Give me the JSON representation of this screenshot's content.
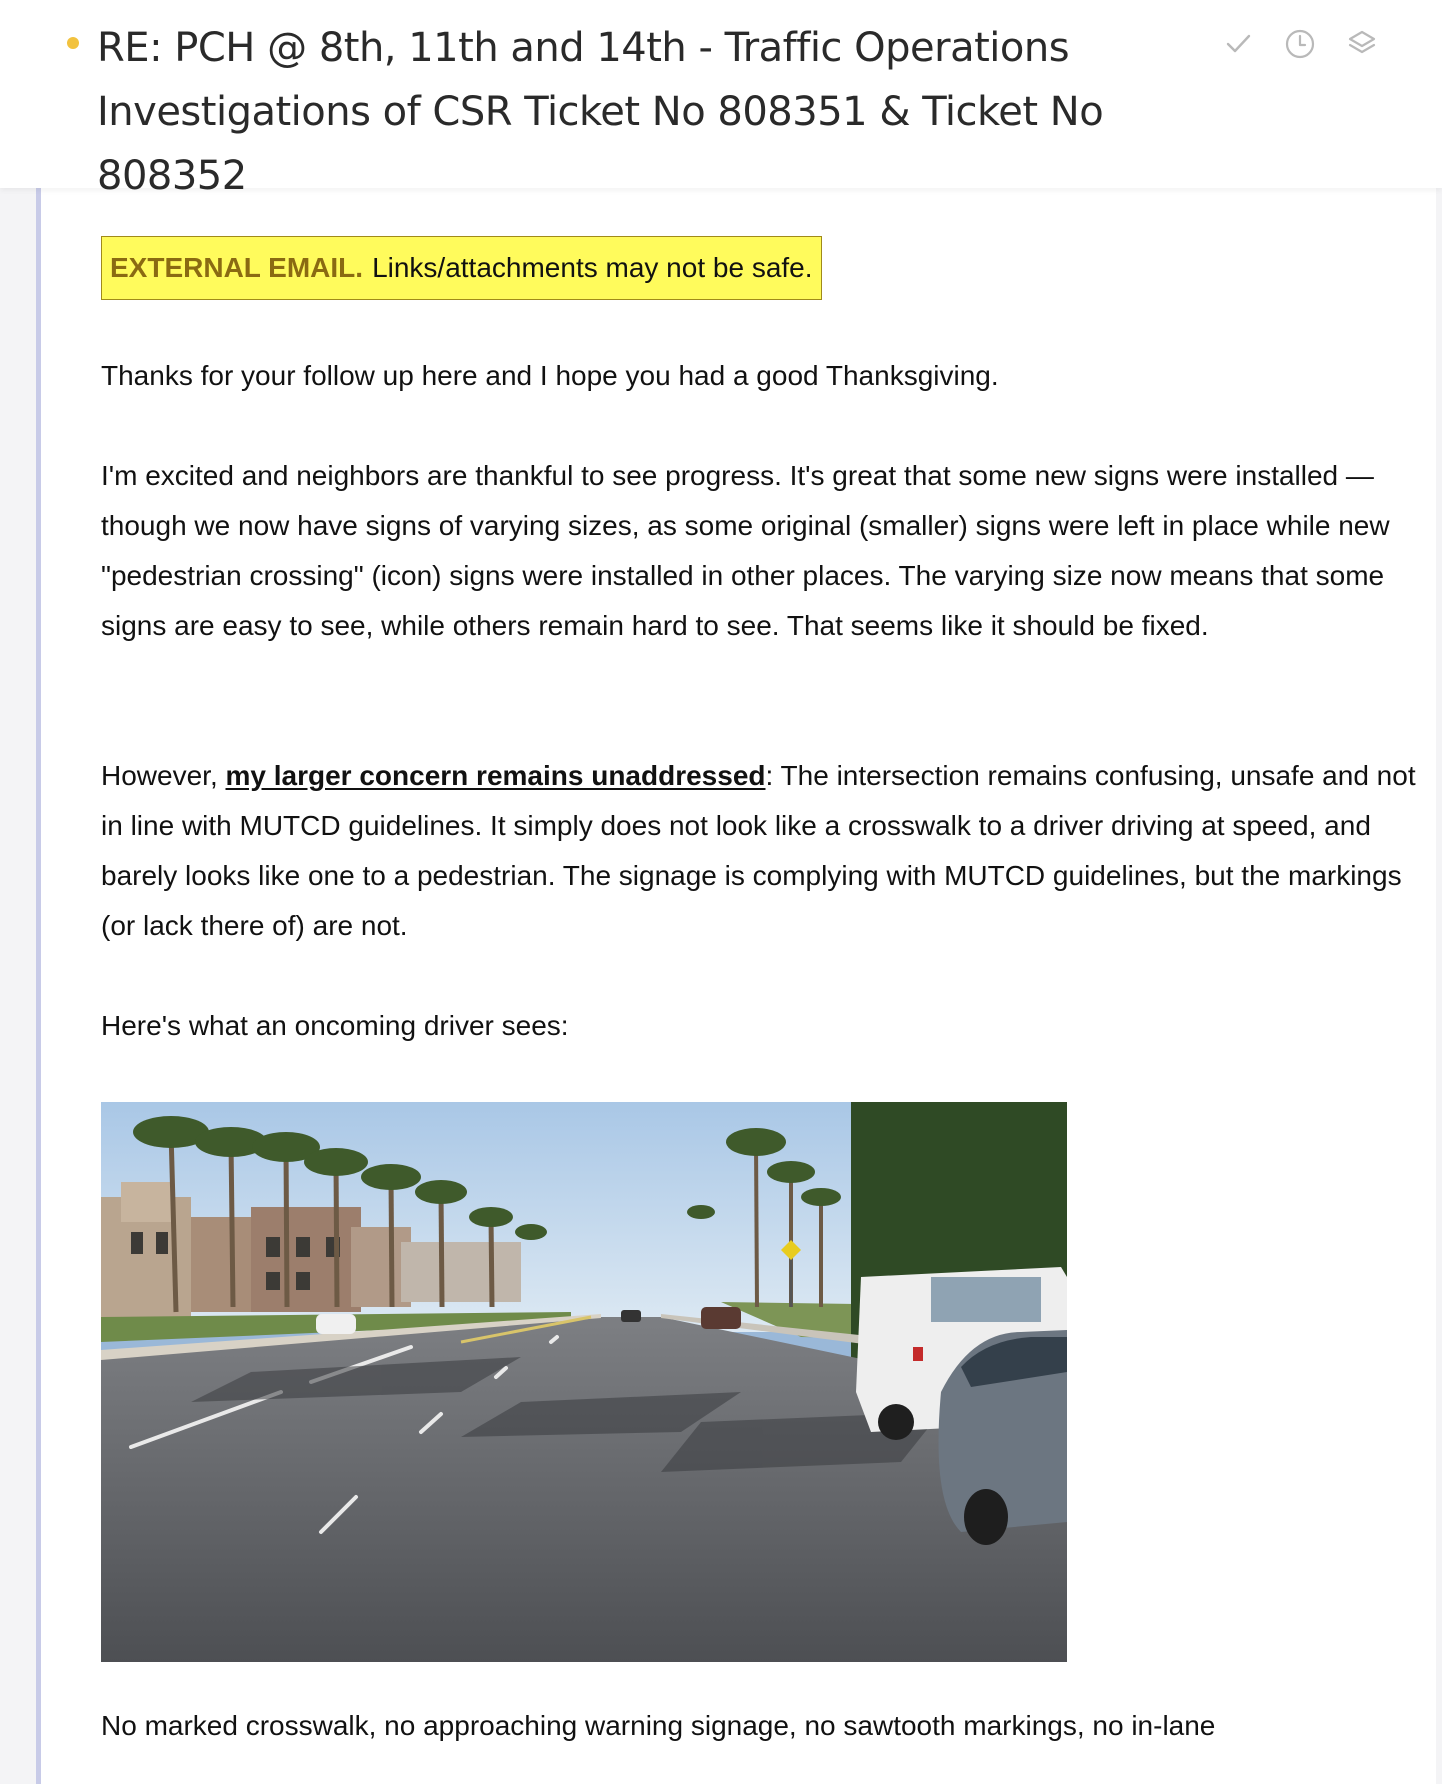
{
  "header": {
    "subject": "RE: PCH @ 8th, 11th and 14th - Traffic Operations Investigations of CSR Ticket No 808351 & Ticket No 808352",
    "unread_color": "#f2c23e",
    "actions": [
      {
        "name": "mark-done",
        "icon": "check-icon"
      },
      {
        "name": "snooze",
        "icon": "clock-icon"
      },
      {
        "name": "move",
        "icon": "layers-icon"
      }
    ]
  },
  "message": {
    "banner": {
      "label": "EXTERNAL EMAIL.",
      "text": "Links/attachments may not be safe."
    },
    "paragraphs": {
      "p1": "Thanks for your follow up here and I hope you had a good Thanksgiving.",
      "p2": "I'm excited and neighbors are thankful to see progress. It's great that some new signs were installed — though we now have signs of varying sizes, as some original (smaller) signs were left in place while new \"pedestrian crossing\" (icon) signs were installed in other places. The varying size now means that some signs are easy to see, while others remain hard to see. That seems like it should be fixed.",
      "p3_prefix": "However, ",
      "p3_emphasis": "my larger concern remains unaddressed",
      "p3_suffix": ": The intersection remains confusing, unsafe and not in line with MUTCD guidelines. It simply does not look like a crosswalk to a driver driving at speed, and barely looks like one to a pedestrian. The signage is complying with MUTCD guidelines, but the markings (or lack there of) are not.",
      "p4": "Here's what an oncoming driver sees:",
      "p5": "No marked crosswalk, no approaching warning signage, no sawtooth markings, no in-lane"
    },
    "accent_color": "#c8cbe8",
    "banner_color": "#fffb5c"
  }
}
